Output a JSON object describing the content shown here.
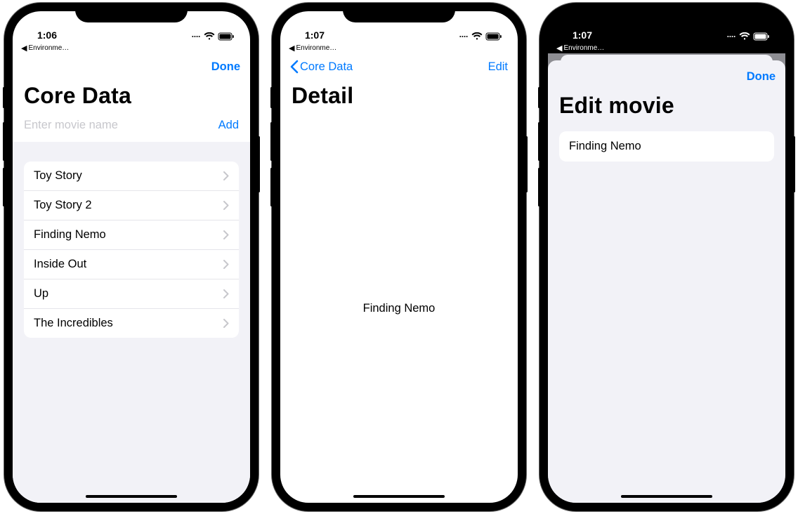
{
  "accent_color": "#007aff",
  "screen1": {
    "status_time": "1:06",
    "breadcrumb": "Environme…",
    "nav_right": "Done",
    "large_title": "Core Data",
    "input_placeholder": "Enter movie name",
    "add_label": "Add",
    "rows": [
      {
        "title": "Toy Story"
      },
      {
        "title": "Toy Story 2"
      },
      {
        "title": "Finding Nemo"
      },
      {
        "title": "Inside Out"
      },
      {
        "title": "Up"
      },
      {
        "title": "The Incredibles"
      }
    ]
  },
  "screen2": {
    "status_time": "1:07",
    "breadcrumb": "Environme…",
    "back_label": "Core Data",
    "nav_right": "Edit",
    "large_title": "Detail",
    "detail_text": "Finding Nemo"
  },
  "screen3": {
    "status_time": "1:07",
    "breadcrumb": "Environme…",
    "nav_right": "Done",
    "large_title": "Edit movie",
    "field_value": "Finding Nemo"
  }
}
